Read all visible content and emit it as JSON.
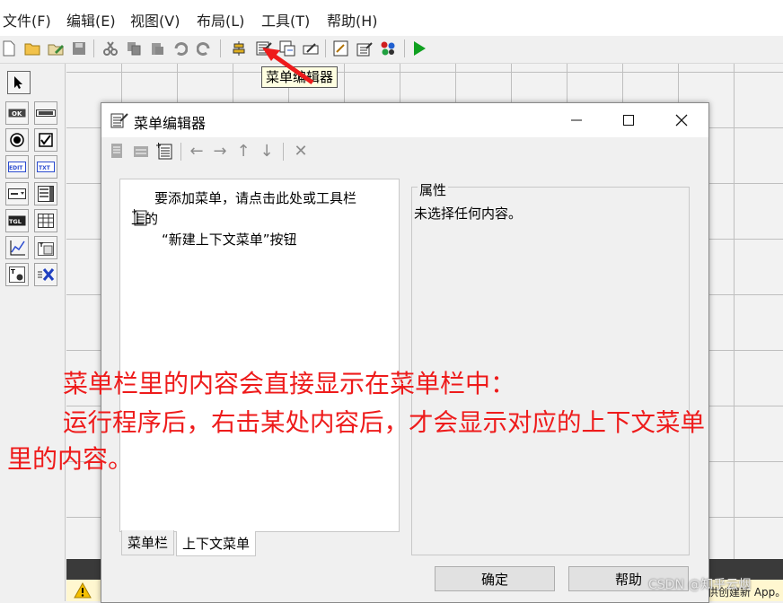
{
  "menubar": {
    "items": [
      "文件(F)",
      "编辑(E)",
      "视图(V)",
      "布局(L)",
      "工具(T)",
      "帮助(H)"
    ]
  },
  "toolbar": {
    "tooltip": "菜单编辑器",
    "icons": [
      "new-file-icon",
      "open-folder-icon",
      "edit-icon",
      "save-icon",
      "cut-icon",
      "copy-icon",
      "paste-icon",
      "undo-icon",
      "redo-icon",
      "align-icon",
      "menu-editor-icon",
      "tab-order-icon",
      "toolbar-editor-icon",
      "editor-icon",
      "inspector-icon",
      "object-browser-icon",
      "run-icon"
    ]
  },
  "dialog": {
    "title": "菜单编辑器",
    "hint_lines": [
      "要添加菜单，请点击此处或工具栏",
      "上的",
      "“新建上下文菜单”按钮"
    ],
    "props_legend": "属性",
    "props_empty": "未选择任何内容。",
    "tabs": [
      "菜单栏",
      "上下文菜单"
    ],
    "ok_label": "确定",
    "help_label": "帮助"
  },
  "annotation": {
    "lines": [
      "菜单栏里的内容会直接显示在菜单栏中：",
      "运行程序后，右击某处内容后，才会显示对应的上下文菜单",
      "里的内容。"
    ],
    "color": "#ee1b1b"
  },
  "footer": {
    "watermark": "CSDN @知乎云烟",
    "status_text": "供创建新 App。"
  }
}
